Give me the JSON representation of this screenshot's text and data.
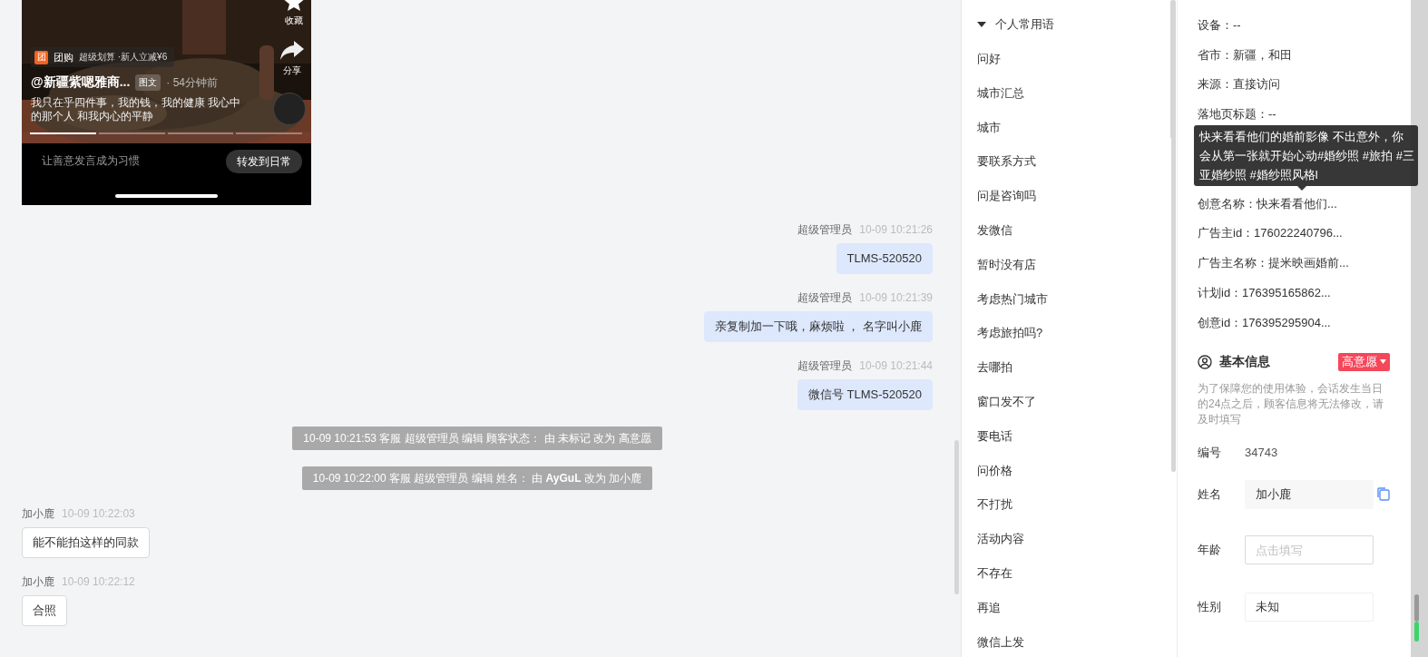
{
  "chat": {
    "shared_post": {
      "actions": [
        {
          "kind": "star",
          "label": "收藏"
        },
        {
          "kind": "share",
          "label": "分享"
        }
      ],
      "promo_badge": "团",
      "promo": "团购",
      "promo_detail": "超级划算 ·新人立减¥6",
      "author": "@新疆紫嗯雅商...",
      "tag": "图文",
      "time": "· 54分钟前",
      "caption": "我只在乎四件事，我的钱，我的健康 我心中的那个人 和我内心的平静",
      "story_segments": [
        {
          "selected": true
        },
        {
          "selected": false
        },
        {
          "selected": false
        },
        {
          "selected": false
        }
      ],
      "comment_placeholder": "让善意发言成为习惯",
      "forward_button": "转发到日常"
    },
    "messages": [
      {
        "kind": "agent",
        "sender": "超级管理员",
        "time": "10-09 10:21:26",
        "text": "TLMS-520520"
      },
      {
        "kind": "agent",
        "sender": "超级管理员",
        "time": "10-09 10:21:39",
        "text": "亲复制加一下哦，麻烦啦 ， 名字叫小鹿"
      },
      {
        "kind": "agent",
        "sender": "超级管理员",
        "time": "10-09 10:21:44",
        "text": "微信号 TLMS-520520"
      },
      {
        "kind": "system",
        "text": "10-09 10:21:53 客服 超级管理员 编辑 顾客状态： 由 未标记 改为 高意愿"
      },
      {
        "kind": "system",
        "text": "10-09 10:22:00 客服 超级管理员 编辑 姓名： 由 **AyGuL** 改为 加小鹿"
      },
      {
        "kind": "customer",
        "sender": "加小鹿",
        "time": "10-09 10:22:03",
        "text": "能不能拍这样的同款"
      },
      {
        "kind": "customer",
        "sender": "加小鹿",
        "time": "10-09 10:22:12",
        "text": "合照"
      }
    ]
  },
  "phrases": {
    "title": "个人常用语",
    "expanded": true,
    "items": [
      "问好",
      "城市汇总",
      "城市",
      "要联系方式",
      "问是咨询吗",
      "发微信",
      "暂时没有店",
      "考虑热门城市",
      "考虑旅拍吗?",
      "去哪拍",
      "窗口发不了",
      "要电话",
      "问价格",
      "不打扰",
      "活动内容",
      "不存在",
      "再追",
      "微信上发"
    ]
  },
  "customer_info": {
    "source_rows": [
      "设备：--",
      "省市：新疆，和田",
      "来源：直接访问",
      "落地页标题：--"
    ],
    "tooltip": "快来看看他们的婚前影像 不出意外，你会从第一张就开始心动#婚纱照 #旅拍 #三亚婚纱照 #婚纱照风格l",
    "ad_rows": [
      "创意名称：快来看看他们...",
      "广告主id：176022240796...",
      "广告主名称：提米映画婚前...",
      "计划id：176395165862...",
      "创意id：176395295904..."
    ],
    "basic_info": {
      "title": "基本信息",
      "intent_tag": "高意愿",
      "note": "为了保障您的使用体验，会话发生当日的24点之后，顾客信息将无法修改，请及时填写",
      "fields": [
        {
          "kind": "static",
          "label": "编号",
          "value": "34743"
        },
        {
          "kind": "filled",
          "label": "姓名",
          "value": "加小鹿"
        },
        {
          "kind": "input",
          "label": "年龄",
          "placeholder": "点击填写"
        },
        {
          "kind": "input",
          "label": "性别",
          "value": "未知"
        }
      ]
    }
  }
}
